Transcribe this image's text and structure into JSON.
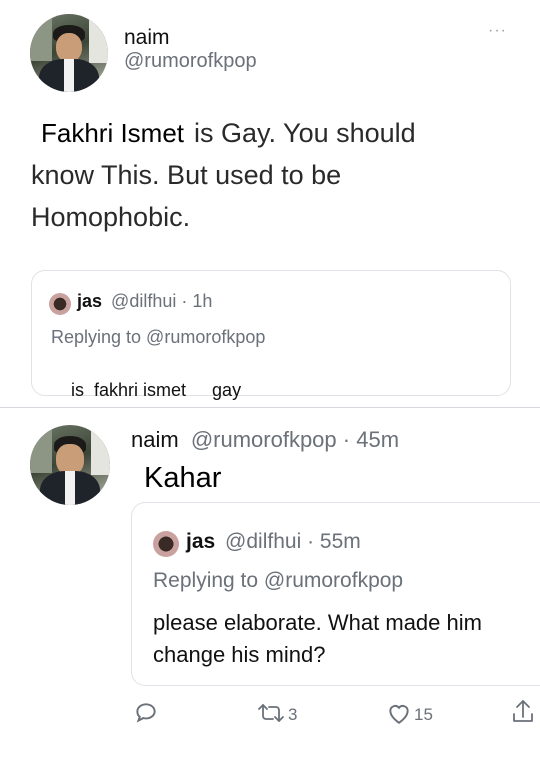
{
  "tweet": {
    "author_name": "naim",
    "author_handle": "@rumorofkpop",
    "more_menu": "···",
    "text_name": "Fakhri Ismet",
    "text_rest_1": "is Gay. You should",
    "text_line2": "know This. But used to be",
    "text_line3": "Homophobic.",
    "quoted": {
      "name": "jas",
      "handle": "@dilfhui",
      "time": "· 1h",
      "replying_to": "Replying to @rumorofkpop",
      "text_part1": "is  fakhri ismet",
      "text_part2": "gay"
    }
  },
  "reply": {
    "author_name": "naim",
    "author_handle": "@rumorofkpop",
    "time": "· 45m",
    "text": "Kahar",
    "quoted": {
      "name": "jas",
      "handle": "@dilfhui",
      "time": "· 55m",
      "replying_to": "Replying to @rumorofkpop",
      "text_line1": "please elaborate. What made him",
      "text_line2": "change his mind?"
    },
    "actions": {
      "retweet_count": "3",
      "like_count": "15"
    }
  },
  "colors": {
    "muted": "#6b7179",
    "border": "#dfe3e7"
  }
}
